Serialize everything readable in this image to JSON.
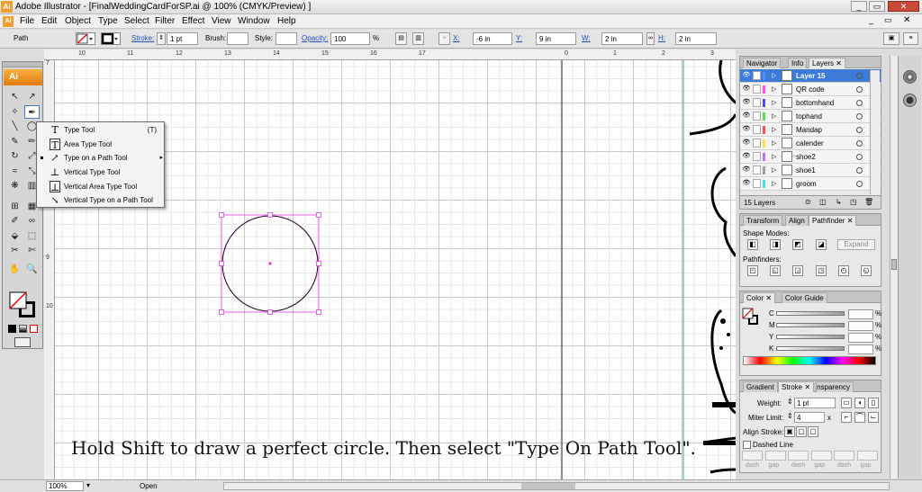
{
  "window": {
    "app_badge": "Ai",
    "title": "Adobe Illustrator - [FinalWeddingCardForSP.ai @ 100% (CMYK/Preview) ]",
    "minimize_glyph": "_",
    "restore_glyph": "▭",
    "close_glyph": "✕"
  },
  "menubar": {
    "doc_badge": "Ai",
    "items": [
      "File",
      "Edit",
      "Object",
      "Type",
      "Select",
      "Filter",
      "Effect",
      "View",
      "Window",
      "Help"
    ],
    "child_close_glyph": "✕"
  },
  "controlbar": {
    "context_label": "Path",
    "stroke_label": "Stroke:",
    "stroke_value": "1 pt",
    "brush_label": "Brush:",
    "style_label": "Style:",
    "opacity_label": "Opacity:",
    "opacity_value": "100",
    "opacity_unit": "%",
    "x_label": "X:",
    "x_value": "-6 in",
    "y_label": "Y:",
    "y_value": "9 in",
    "w_label": "W:",
    "w_value": "2 in",
    "h_label": "H:",
    "h_value": "2 in"
  },
  "rulers": {
    "top": [
      "10",
      "11",
      "12",
      "13",
      "14",
      "15",
      "16",
      "17",
      "0",
      "1",
      "2",
      "3"
    ],
    "left": [
      "7",
      "8",
      "9",
      "10"
    ]
  },
  "tools_panel": {
    "badge": "Ai",
    "icons": [
      "selection-arrow-icon",
      "direct-selection-icon",
      "magic-wand-icon",
      "type-tool-icon",
      "line-tool-icon",
      "ellipse-tool-icon",
      "paintbrush-icon",
      "pencil-icon",
      "rotate-icon",
      "scale-icon",
      "warp-icon",
      "free-transform-icon",
      "symbol-sprayer-icon",
      "graph-icon",
      "mesh-icon",
      "gradient-icon",
      "eyedropper-icon",
      "blend-icon",
      "live-paint-icon",
      "live-paint-select-icon",
      "slice-icon",
      "scissors-icon",
      "hand-icon",
      "zoom-icon",
      "fill-stroke-icon",
      "color-mode-icons",
      "screen-mode-icon"
    ]
  },
  "type_flyout": {
    "items": [
      {
        "icon": "T",
        "label": "Type Tool",
        "shortcut": "(T)",
        "selected": false
      },
      {
        "icon": "T",
        "label": "Area Type Tool",
        "shortcut": "",
        "selected": false
      },
      {
        "icon": "↗",
        "label": "Type on a Path Tool",
        "shortcut": "",
        "selected": true
      },
      {
        "icon": "⊥",
        "label": "Vertical Type Tool",
        "shortcut": "",
        "selected": false
      },
      {
        "icon": "⊥",
        "label": "Vertical Area Type Tool",
        "shortcut": "",
        "selected": false
      },
      {
        "icon": "↘",
        "label": "Vertical Type on a Path Tool",
        "shortcut": "",
        "selected": false
      }
    ]
  },
  "layers_panel": {
    "tabs": [
      "Navigator",
      "Info",
      "Layers"
    ],
    "rows": [
      {
        "name": "Layer 15",
        "color": "#4d8eff",
        "selected": true
      },
      {
        "name": "QR code",
        "color": "#ff4fff",
        "selected": false
      },
      {
        "name": "bottomhand",
        "color": "#4f4fff",
        "selected": false
      },
      {
        "name": "tophand",
        "color": "#4fdf4f",
        "selected": false
      },
      {
        "name": "Mandap",
        "color": "#ff4f4f",
        "selected": false
      },
      {
        "name": "calender",
        "color": "#ffdf4f",
        "selected": false
      },
      {
        "name": "shoe2",
        "color": "#c070ff",
        "selected": false
      },
      {
        "name": "shoe1",
        "color": "#a0a0a0",
        "selected": false
      },
      {
        "name": "groom",
        "color": "#4fdfdf",
        "selected": false
      }
    ],
    "footer_count": "15 Layers"
  },
  "pathfinder_panel": {
    "tabs": [
      "Transform",
      "Align",
      "Pathfinder"
    ],
    "shape_modes_label": "Shape Modes:",
    "expand_label": "Expand",
    "pathfinders_label": "Pathfinders:"
  },
  "color_panel": {
    "tabs": [
      "Color",
      "Color Guide"
    ],
    "channels": [
      "C",
      "M",
      "Y",
      "K"
    ],
    "percent": "%"
  },
  "stroke_panel": {
    "tabs": [
      "Gradient",
      "Stroke",
      "Transparency"
    ],
    "weight_label": "Weight:",
    "weight_value": "1 pt",
    "miter_label": "Miter Limit:",
    "miter_value": "4",
    "miter_unit": "x",
    "align_label": "Align Stroke:",
    "dashed_label": "Dashed Line",
    "dash_labels": [
      "dash",
      "gap",
      "dash",
      "gap",
      "dash",
      "gap"
    ]
  },
  "statusbar": {
    "zoom": "100%",
    "status": "Open"
  },
  "caption": "Hold Shift to draw a perfect circle. Then select \"Type On Path Tool\"."
}
